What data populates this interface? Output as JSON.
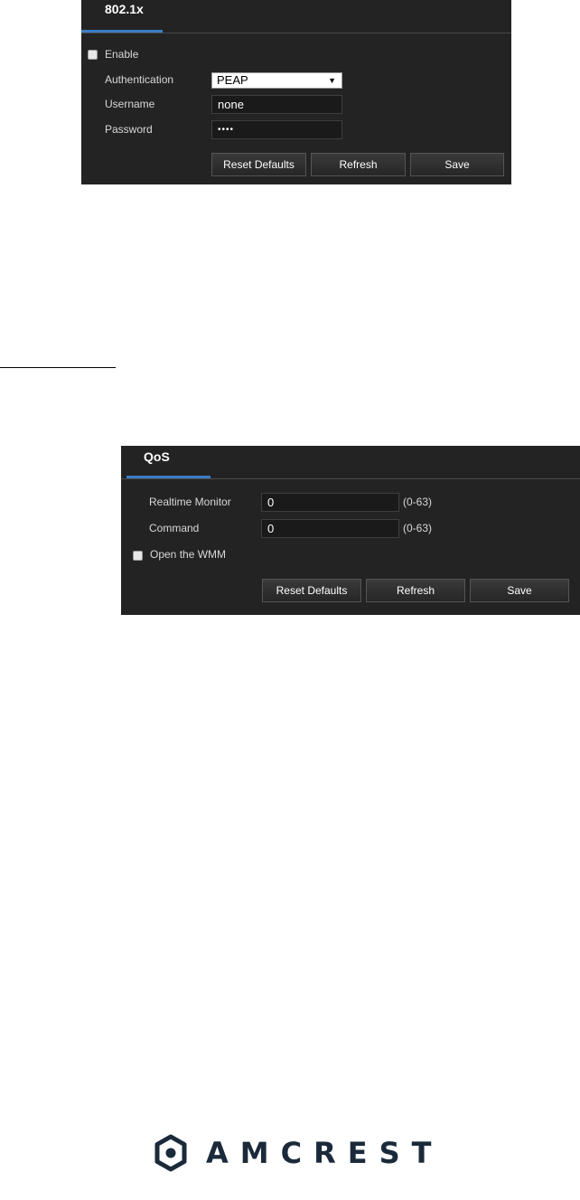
{
  "dot1x": {
    "tab_title": "802.1x",
    "enable_label": "Enable",
    "auth_label": "Authentication",
    "auth_value": "PEAP",
    "username_label": "Username",
    "username_value": "none",
    "password_label": "Password",
    "password_value": "••••",
    "btn_reset": "Reset Defaults",
    "btn_refresh": "Refresh",
    "btn_save": "Save"
  },
  "qos": {
    "tab_title": "QoS",
    "realtime_label": "Realtime Monitor",
    "realtime_value": "0",
    "realtime_range": "(0-63)",
    "command_label": "Command",
    "command_value": "0",
    "command_range": "(0-63)",
    "wmm_label": "Open the WMM",
    "btn_reset": "Reset Defaults",
    "btn_refresh": "Refresh",
    "btn_save": "Save"
  },
  "brand": {
    "name": "AMCREST",
    "color": "#1b2a3a",
    "accent": "#3a7ec6"
  }
}
